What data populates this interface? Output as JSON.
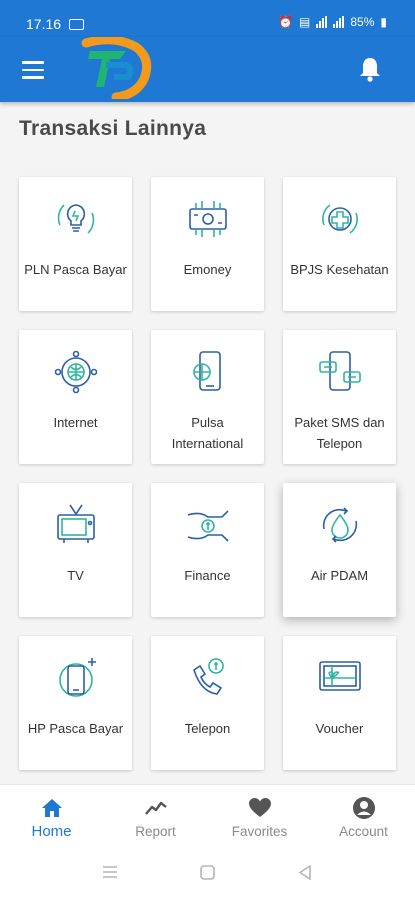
{
  "status_bar": {
    "time": "17.16",
    "battery": "85%"
  },
  "app_bar": {
    "menu_icon": "hamburger-menu-icon",
    "logo": "app-logo",
    "notification_icon": "bell-icon"
  },
  "page": {
    "title": "Transaksi Lainnya"
  },
  "services": [
    {
      "label": "PLN Pasca Bayar",
      "icon": "lightbulb-icon"
    },
    {
      "label": "Emoney",
      "icon": "emoney-chip-icon"
    },
    {
      "label": "BPJS Kesehatan",
      "icon": "health-cross-icon"
    },
    {
      "label": "Internet",
      "icon": "globe-network-icon"
    },
    {
      "label": "Pulsa International",
      "icon": "phone-globe-icon"
    },
    {
      "label": "Paket SMS dan Telepon",
      "icon": "phone-chat-icon"
    },
    {
      "label": "TV",
      "icon": "tv-icon"
    },
    {
      "label": "Finance",
      "icon": "hands-money-icon"
    },
    {
      "label": "Air PDAM",
      "icon": "water-drop-icon"
    },
    {
      "label": "HP Pasca Bayar",
      "icon": "smartphone-plus-icon"
    },
    {
      "label": "Telepon",
      "icon": "telephone-money-icon"
    },
    {
      "label": "Voucher",
      "icon": "gift-voucher-icon"
    }
  ],
  "bottom_nav": [
    {
      "label": "Home",
      "icon": "home-icon",
      "active": true
    },
    {
      "label": "Report",
      "icon": "chart-line-icon",
      "active": false
    },
    {
      "label": "Favorites",
      "icon": "heart-icon",
      "active": false
    },
    {
      "label": "Account",
      "icon": "account-icon",
      "active": false
    }
  ],
  "colors": {
    "primary": "#1e78d4",
    "icon_blue": "#2b5fa8",
    "icon_teal": "#2fb5a0",
    "logo_orange": "#f39a1c",
    "logo_green": "#21b573"
  }
}
